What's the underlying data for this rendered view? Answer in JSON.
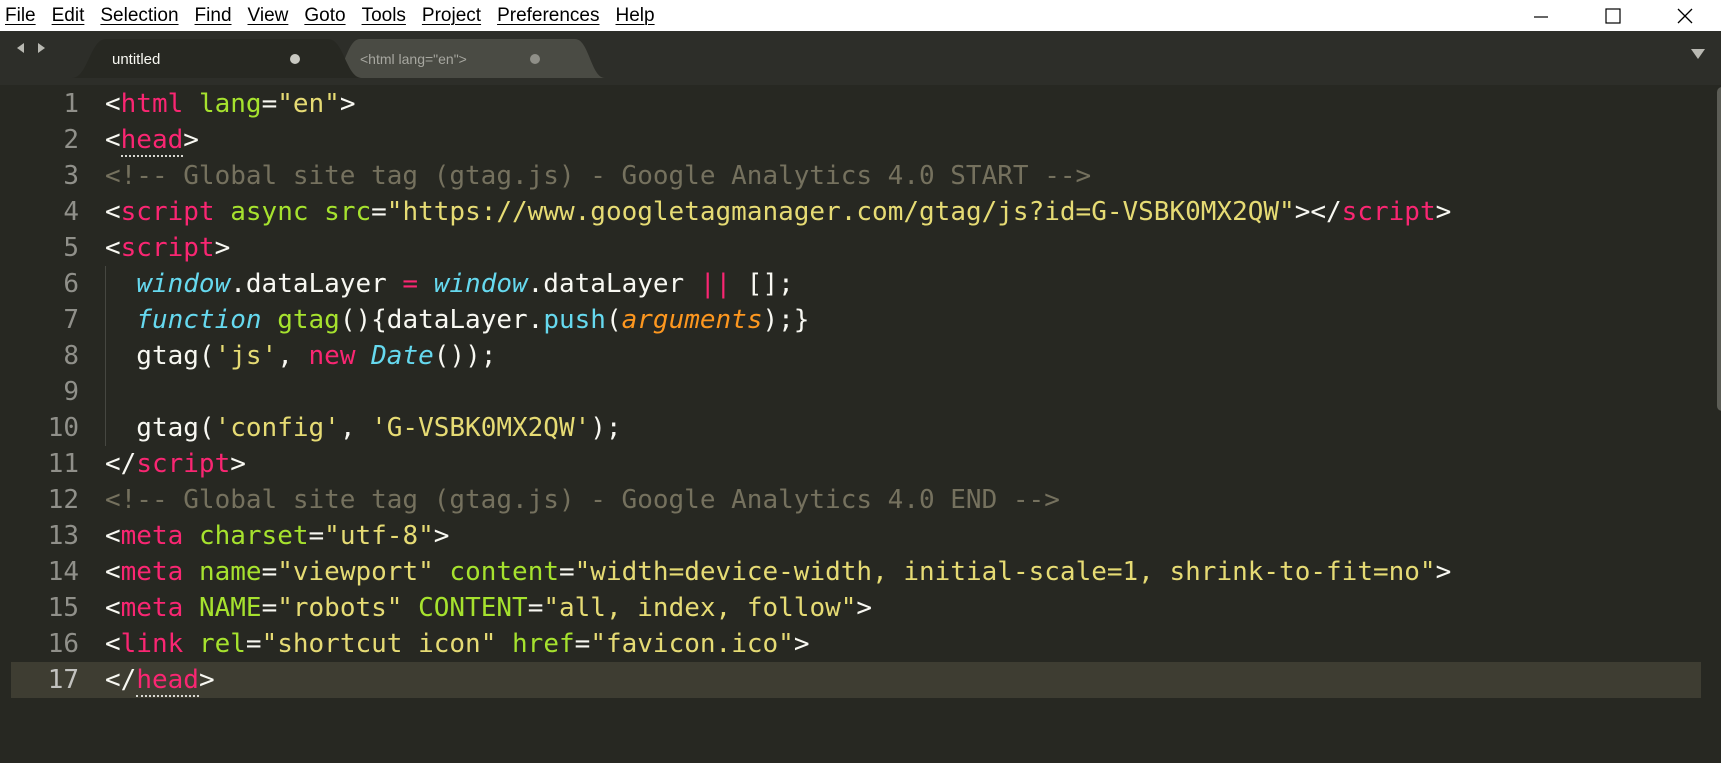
{
  "menu": [
    "File",
    "Edit",
    "Selection",
    "Find",
    "View",
    "Goto",
    "Tools",
    "Project",
    "Preferences",
    "Help"
  ],
  "window_controls": [
    "minimize-icon",
    "maximize-icon",
    "close-icon"
  ],
  "tabs": [
    {
      "label": "untitled",
      "active": true,
      "modified": true
    },
    {
      "label": "<html lang=\"en\">",
      "active": false,
      "modified": true
    }
  ],
  "editor": {
    "theme": {
      "background": "#272822",
      "tag": "#f92672",
      "attribute": "#a6e22e",
      "string": "#e6db74",
      "comment": "#75715e",
      "support": "#66d9ef",
      "argument": "#fd971f"
    },
    "current_line": 17,
    "lines": [
      {
        "n": "1",
        "tokens": [
          [
            "p",
            "<"
          ],
          [
            "t",
            "html"
          ],
          [
            "p",
            " "
          ],
          [
            "a",
            "lang"
          ],
          [
            "p",
            "="
          ],
          [
            "s",
            "\"en\""
          ],
          [
            "p",
            ">"
          ]
        ]
      },
      {
        "n": "2",
        "tokens": [
          [
            "p",
            "<"
          ],
          [
            "t",
            "head"
          ],
          [
            "p",
            ">"
          ]
        ]
      },
      {
        "n": "3",
        "tokens": [
          [
            "c",
            "<!-- Global site tag (gtag.js) - Google Analytics 4.0 START -->"
          ]
        ]
      },
      {
        "n": "4",
        "tokens": [
          [
            "p",
            "<"
          ],
          [
            "t",
            "script"
          ],
          [
            "p",
            " "
          ],
          [
            "a",
            "async"
          ],
          [
            "p",
            " "
          ],
          [
            "a",
            "src"
          ],
          [
            "p",
            "="
          ],
          [
            "s",
            "\"https://www.googletagmanager.com/gtag/js?id=G-VSBK0MX2QW\""
          ],
          [
            "p",
            "></"
          ],
          [
            "t",
            "script"
          ],
          [
            "p",
            ">"
          ]
        ]
      },
      {
        "n": "5",
        "tokens": [
          [
            "p",
            "<"
          ],
          [
            "t",
            "script"
          ],
          [
            "p",
            ">"
          ]
        ]
      },
      {
        "n": "6",
        "tokens": [
          [
            "p",
            "  "
          ],
          [
            "sv",
            "window"
          ],
          [
            "p",
            ".dataLayer "
          ],
          [
            "k",
            "="
          ],
          [
            "p",
            " "
          ],
          [
            "sv",
            "window"
          ],
          [
            "p",
            ".dataLayer "
          ],
          [
            "k",
            "||"
          ],
          [
            "p",
            " [];"
          ]
        ]
      },
      {
        "n": "7",
        "tokens": [
          [
            "p",
            "  "
          ],
          [
            "sv",
            "function"
          ],
          [
            "p",
            " "
          ],
          [
            "a",
            "gtag"
          ],
          [
            "p",
            "(){dataLayer."
          ],
          [
            "fn",
            "push"
          ],
          [
            "p",
            "("
          ],
          [
            "arg",
            "arguments"
          ],
          [
            "p",
            ");}"
          ]
        ]
      },
      {
        "n": "8",
        "tokens": [
          [
            "p",
            "  gtag("
          ],
          [
            "s",
            "'js'"
          ],
          [
            "p",
            ", "
          ],
          [
            "k",
            "new"
          ],
          [
            "p",
            " "
          ],
          [
            "sv",
            "Date"
          ],
          [
            "p",
            "());"
          ]
        ]
      },
      {
        "n": "9",
        "tokens": []
      },
      {
        "n": "10",
        "tokens": [
          [
            "p",
            "  gtag("
          ],
          [
            "s",
            "'config'"
          ],
          [
            "p",
            ", "
          ],
          [
            "s",
            "'G-VSBK0MX2QW'"
          ],
          [
            "p",
            ");"
          ]
        ]
      },
      {
        "n": "11",
        "tokens": [
          [
            "p",
            "</"
          ],
          [
            "t",
            "script"
          ],
          [
            "p",
            ">"
          ]
        ]
      },
      {
        "n": "12",
        "tokens": [
          [
            "c",
            "<!-- Global site tag (gtag.js) - Google Analytics 4.0 END -->"
          ]
        ]
      },
      {
        "n": "13",
        "tokens": [
          [
            "p",
            "<"
          ],
          [
            "t",
            "meta"
          ],
          [
            "p",
            " "
          ],
          [
            "a",
            "charset"
          ],
          [
            "p",
            "="
          ],
          [
            "s",
            "\"utf-8\""
          ],
          [
            "p",
            ">"
          ]
        ]
      },
      {
        "n": "14",
        "tokens": [
          [
            "p",
            "<"
          ],
          [
            "t",
            "meta"
          ],
          [
            "p",
            " "
          ],
          [
            "a",
            "name"
          ],
          [
            "p",
            "="
          ],
          [
            "s",
            "\"viewport\""
          ],
          [
            "p",
            " "
          ],
          [
            "a",
            "content"
          ],
          [
            "p",
            "="
          ],
          [
            "s",
            "\"width=device-width, initial-scale=1, shrink-to-fit=no\""
          ],
          [
            "p",
            ">"
          ]
        ]
      },
      {
        "n": "15",
        "tokens": [
          [
            "p",
            "<"
          ],
          [
            "t",
            "meta"
          ],
          [
            "p",
            " "
          ],
          [
            "a",
            "NAME"
          ],
          [
            "p",
            "="
          ],
          [
            "s",
            "\"robots\""
          ],
          [
            "p",
            " "
          ],
          [
            "a",
            "CONTENT"
          ],
          [
            "p",
            "="
          ],
          [
            "s",
            "\"all, index, follow\""
          ],
          [
            "p",
            ">"
          ]
        ]
      },
      {
        "n": "16",
        "tokens": [
          [
            "p",
            "<"
          ],
          [
            "t",
            "link"
          ],
          [
            "p",
            " "
          ],
          [
            "a",
            "rel"
          ],
          [
            "p",
            "="
          ],
          [
            "s",
            "\"shortcut icon\""
          ],
          [
            "p",
            " "
          ],
          [
            "a",
            "href"
          ],
          [
            "p",
            "="
          ],
          [
            "s",
            "\"favicon.ico\""
          ],
          [
            "p",
            ">"
          ]
        ]
      },
      {
        "n": "17",
        "tokens": [
          [
            "p",
            "</"
          ],
          [
            "t",
            "head"
          ],
          [
            "p",
            ">"
          ]
        ]
      }
    ]
  }
}
